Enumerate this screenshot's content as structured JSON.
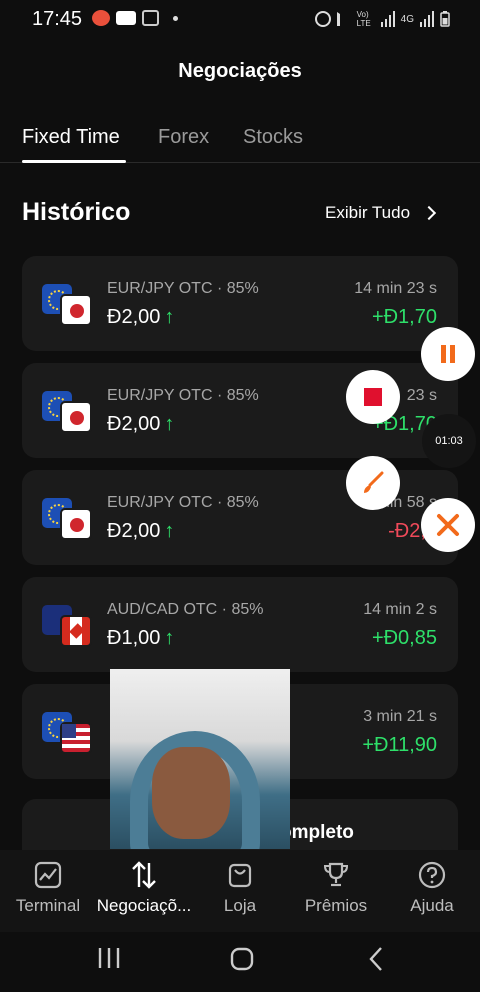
{
  "status_bar": {
    "time": "17:45",
    "network_label": "4G",
    "volte_label": "Vo) LTE",
    "icons": [
      "notification-app-icon",
      "youtube-icon",
      "gallery-icon",
      "dot-icon",
      "alarm-icon",
      "mute-icon",
      "signal-icon",
      "signal-icon",
      "battery-icon"
    ]
  },
  "header": {
    "title": "Negociações"
  },
  "tabs": [
    {
      "label": "Fixed Time",
      "active": true
    },
    {
      "label": "Forex",
      "active": false
    },
    {
      "label": "Stocks",
      "active": false
    }
  ],
  "history": {
    "title": "Histórico",
    "view_all": "Exibir Tudo",
    "trades": [
      {
        "pair": "EUR/JPY OTC · 85%",
        "amount": "Đ2,00",
        "direction": "up",
        "duration": "14 min 23 s",
        "result": "+Đ1,70",
        "result_type": "positive",
        "flags": [
          "eu",
          "jp"
        ]
      },
      {
        "pair": "EUR/JPY OTC · 85%",
        "amount": "Đ2,00",
        "direction": "up",
        "duration": "23 s",
        "result": "+Đ1,70",
        "result_type": "positive",
        "flags": [
          "eu",
          "jp"
        ]
      },
      {
        "pair": "EUR/JPY OTC · 85%",
        "amount": "Đ2,00",
        "direction": "up",
        "duration": "1 min 58 s",
        "result": "-Đ2,0",
        "result_type": "negative",
        "flags": [
          "eu",
          "jp"
        ]
      },
      {
        "pair": "AUD/CAD OTC · 85%",
        "amount": "Đ1,00",
        "direction": "up",
        "duration": "14 min 2 s",
        "result": "+Đ0,85",
        "result_type": "positive",
        "flags": [
          "au",
          "ca"
        ]
      },
      {
        "pair": "",
        "amount": "",
        "direction": "",
        "duration": "3 min 21 s",
        "result": "+Đ11,90",
        "result_type": "positive",
        "flags": [
          "eu",
          "us"
        ]
      }
    ],
    "full_history_label": "ompleto"
  },
  "overlay": {
    "timer": "01:03",
    "buttons": [
      "pause-icon",
      "stop-icon",
      "brush-icon",
      "tools-icon"
    ]
  },
  "bottom_nav": [
    {
      "label": "Terminal",
      "icon": "chart-icon",
      "active": false
    },
    {
      "label": "Negociaçõ...",
      "icon": "swap-arrows-icon",
      "active": true
    },
    {
      "label": "Loja",
      "icon": "shopping-bag-icon",
      "active": false
    },
    {
      "label": "Prêmios",
      "icon": "trophy-icon",
      "active": false
    },
    {
      "label": "Ajuda",
      "icon": "help-icon",
      "active": false
    }
  ],
  "colors": {
    "background": "#0e0e0e",
    "card": "#1b1b1b",
    "positive": "#2ee06a",
    "negative": "#f04a5a",
    "accent_orange": "#f26a1b",
    "stop_red": "#e0102e"
  }
}
